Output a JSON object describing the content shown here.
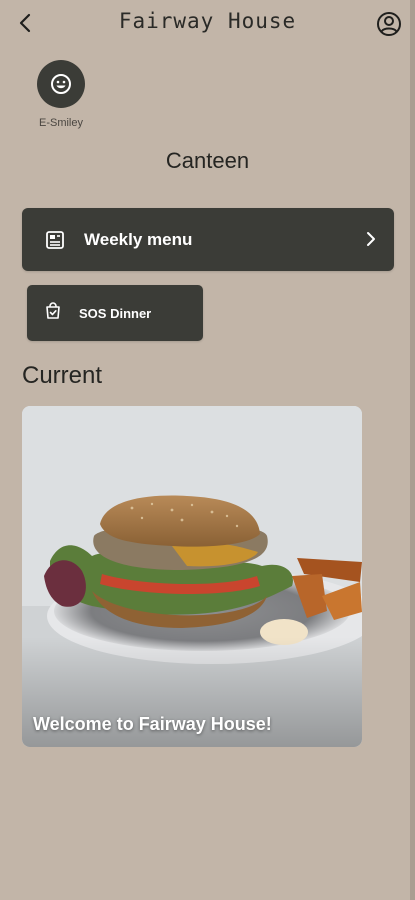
{
  "header": {
    "title": "Fairway House",
    "back_icon": "chevron-left-icon",
    "profile_icon": "user-circle-icon"
  },
  "esmiley": {
    "label": "E-Smiley",
    "icon": "smiley-icon"
  },
  "section": {
    "title": "Canteen"
  },
  "buttons": {
    "weekly_menu": {
      "label": "Weekly menu",
      "icon": "menu-book-icon"
    },
    "sos_dinner": {
      "label": "SOS Dinner",
      "icon": "shopping-bag-check-icon"
    }
  },
  "current": {
    "heading": "Current",
    "card": {
      "caption": "Welcome to Fairway House!",
      "image": "burger-with-potato-wedges-photo"
    }
  },
  "colors": {
    "background": "#c2b5a8",
    "button": "#3b3c37",
    "text_dark": "#2b2b28",
    "text_light": "#ffffff"
  }
}
